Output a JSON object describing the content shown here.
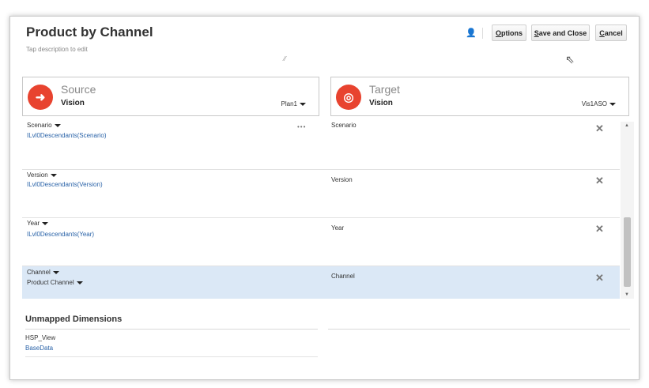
{
  "header": {
    "title": "Product by Channel",
    "description_placeholder": "Tap description to edit",
    "buttons": {
      "options": "Options",
      "save_close": "Save and Close",
      "cancel": "Cancel"
    }
  },
  "source": {
    "label": "Source",
    "app": "Vision",
    "cube": "Plan1"
  },
  "target": {
    "label": "Target",
    "app": "Vision",
    "cube": "Vis1ASO"
  },
  "rows": [
    {
      "dimension": "Scenario",
      "member": "ILvl0Descendants(Scenario)",
      "target": "Scenario"
    },
    {
      "dimension": "Version",
      "member": "ILvl0Descendants(Version)",
      "target": "Version"
    },
    {
      "dimension": "Year",
      "member": "ILvl0Descendants(Year)",
      "target": "Year"
    },
    {
      "dimension": "Channel",
      "member": "Product Channel",
      "target": "Channel"
    }
  ],
  "row_actions": {
    "more": "•••"
  },
  "unmapped": {
    "title": "Unmapped Dimensions",
    "items": [
      {
        "dimension": "HSP_View",
        "member": "BaseData"
      }
    ]
  },
  "icons": {
    "source": "source-exit-icon",
    "target": "target-bullseye-icon",
    "delete": "close-icon",
    "header_user": "user-icon"
  },
  "colors": {
    "accent_red": "#e8432f",
    "link_blue": "#2a63a8",
    "selected_row": "#dbe8f6"
  }
}
